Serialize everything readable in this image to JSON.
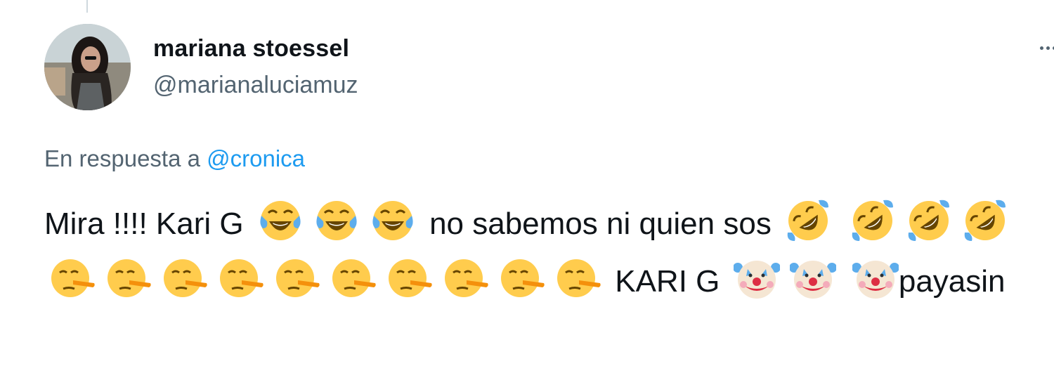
{
  "tweet": {
    "display_name": "mariana stoessel",
    "handle": "@marianaluciamuz",
    "reply_prefix": "En respuesta a",
    "reply_to": "@cronica",
    "text_segments": {
      "s1": "Mira !!!! Kari G",
      "s2": "no sabemos ni quien sos",
      "s3": "KARI G",
      "s4": "payasin"
    },
    "emojis": [
      "face-with-tears-of-joy-icon",
      "rolling-on-floor-laughing-icon",
      "lying-face-icon",
      "clown-face-icon"
    ]
  }
}
